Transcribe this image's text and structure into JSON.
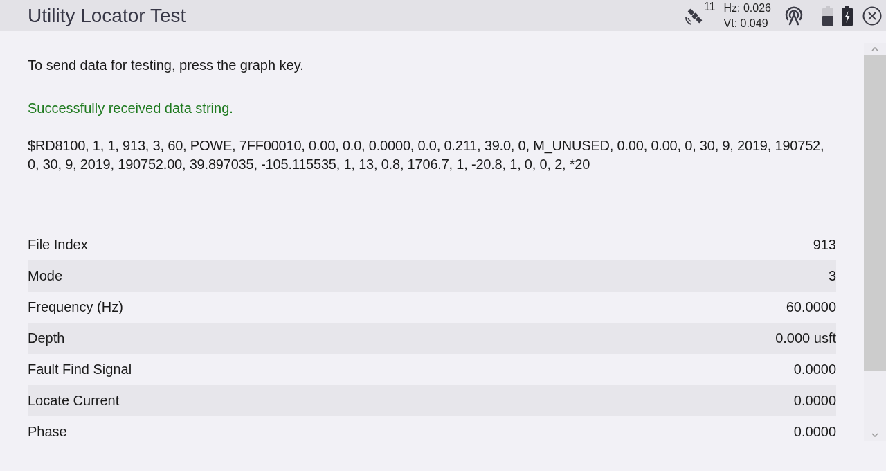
{
  "window": {
    "title": "Utility Locator Test"
  },
  "status": {
    "satellites": "11",
    "hz": "Hz: 0.026",
    "vt": "Vt: 0.049"
  },
  "instruction": "To send data for testing, press the graph key.",
  "message": {
    "kind": "success",
    "text": "Successfully received data string."
  },
  "data_string": "$RD8100, 1, 1, 913, 3, 60, POWE, 7FF00010, 0.00, 0.0, 0.0000, 0.0, 0.211, 39.0, 0, M_UNUSED, 0.00, 0.00, 0, 30, 9, 2019, 190752, 0, 30, 9, 2019, 190752.00, 39.897035, -105.115535, 1, 13, 0.8, 1706.7, 1, -20.8, 1, 0, 0, 2, *20",
  "table": {
    "rows": [
      {
        "label": "File Index",
        "value": "913"
      },
      {
        "label": "Mode",
        "value": "3"
      },
      {
        "label": "Frequency (Hz)",
        "value": "60.0000"
      },
      {
        "label": "Depth",
        "value": "0.000 usft"
      },
      {
        "label": "Fault Find Signal",
        "value": "0.0000"
      },
      {
        "label": "Locate Current",
        "value": "0.0000"
      },
      {
        "label": "Phase",
        "value": "0.0000"
      }
    ]
  }
}
